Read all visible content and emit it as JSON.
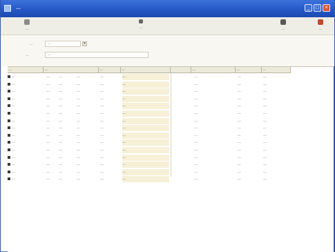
{
  "window": {
    "title": "…",
    "controls": {
      "minimize_icon": "minimize-icon",
      "maximize_icon": "maximize-icon",
      "close_icon": "close-icon"
    }
  },
  "toolbar": {
    "left_label": "…",
    "center_label": "…",
    "right_label_1": "…",
    "right_label_2": "…",
    "icons": [
      "document-icon",
      "arrow-down-icon",
      "printer-icon",
      "door-exit-icon"
    ]
  },
  "filters": {
    "label_1": "…",
    "value_1": "…",
    "label_2": "…",
    "value_2": "…"
  },
  "table": {
    "columns": [
      "…",
      "…",
      "…",
      "…",
      "…",
      "…",
      "…",
      "…"
    ],
    "rows": [
      [
        "…",
        "…",
        "…",
        "…",
        "…",
        "…",
        "…",
        "…",
        "…"
      ],
      [
        "…",
        "…",
        "…",
        "…",
        "…",
        "…",
        "…",
        "…",
        "…"
      ],
      [
        "…",
        "…",
        "…",
        "…",
        "…",
        "…",
        "…",
        "…",
        "…"
      ],
      [
        "…",
        "…",
        "…",
        "…",
        "…",
        "…",
        "…",
        "…",
        "…"
      ],
      [
        "…",
        "…",
        "…",
        "…",
        "…",
        "…",
        "…",
        "…",
        "…"
      ],
      [
        "…",
        "…",
        "…",
        "…",
        "…",
        "…",
        "…",
        "…",
        "…"
      ],
      [
        "…",
        "…",
        "…",
        "…",
        "…",
        "…",
        "…",
        "…",
        "…"
      ],
      [
        "…",
        "…",
        "…",
        "…",
        "…",
        "…",
        "…",
        "…",
        "…"
      ],
      [
        "…",
        "…",
        "…",
        "…",
        "…",
        "…",
        "…",
        "…",
        "…"
      ],
      [
        "…",
        "…",
        "…",
        "…",
        "…",
        "…",
        "…",
        "…",
        "…"
      ],
      [
        "…",
        "…",
        "…",
        "…",
        "…",
        "…",
        "…",
        "…",
        "…"
      ],
      [
        "…",
        "…",
        "…",
        "…",
        "…",
        "…",
        "…",
        "…",
        "…"
      ],
      [
        "…",
        "…",
        "…",
        "…",
        "…",
        "…",
        "…",
        "…",
        "…"
      ],
      [
        "…",
        "…",
        "…",
        "…",
        "…",
        "…",
        "…",
        "…",
        "…"
      ],
      [
        "…",
        "…",
        "…",
        "…",
        "…",
        "…",
        "…",
        "…",
        "…"
      ]
    ]
  },
  "colors": {
    "titlebar": "#2456c4",
    "toolbar_bg": "#efeee6",
    "header_bg": "#ece9d8",
    "highlight_cell": "#f6f0d7"
  }
}
